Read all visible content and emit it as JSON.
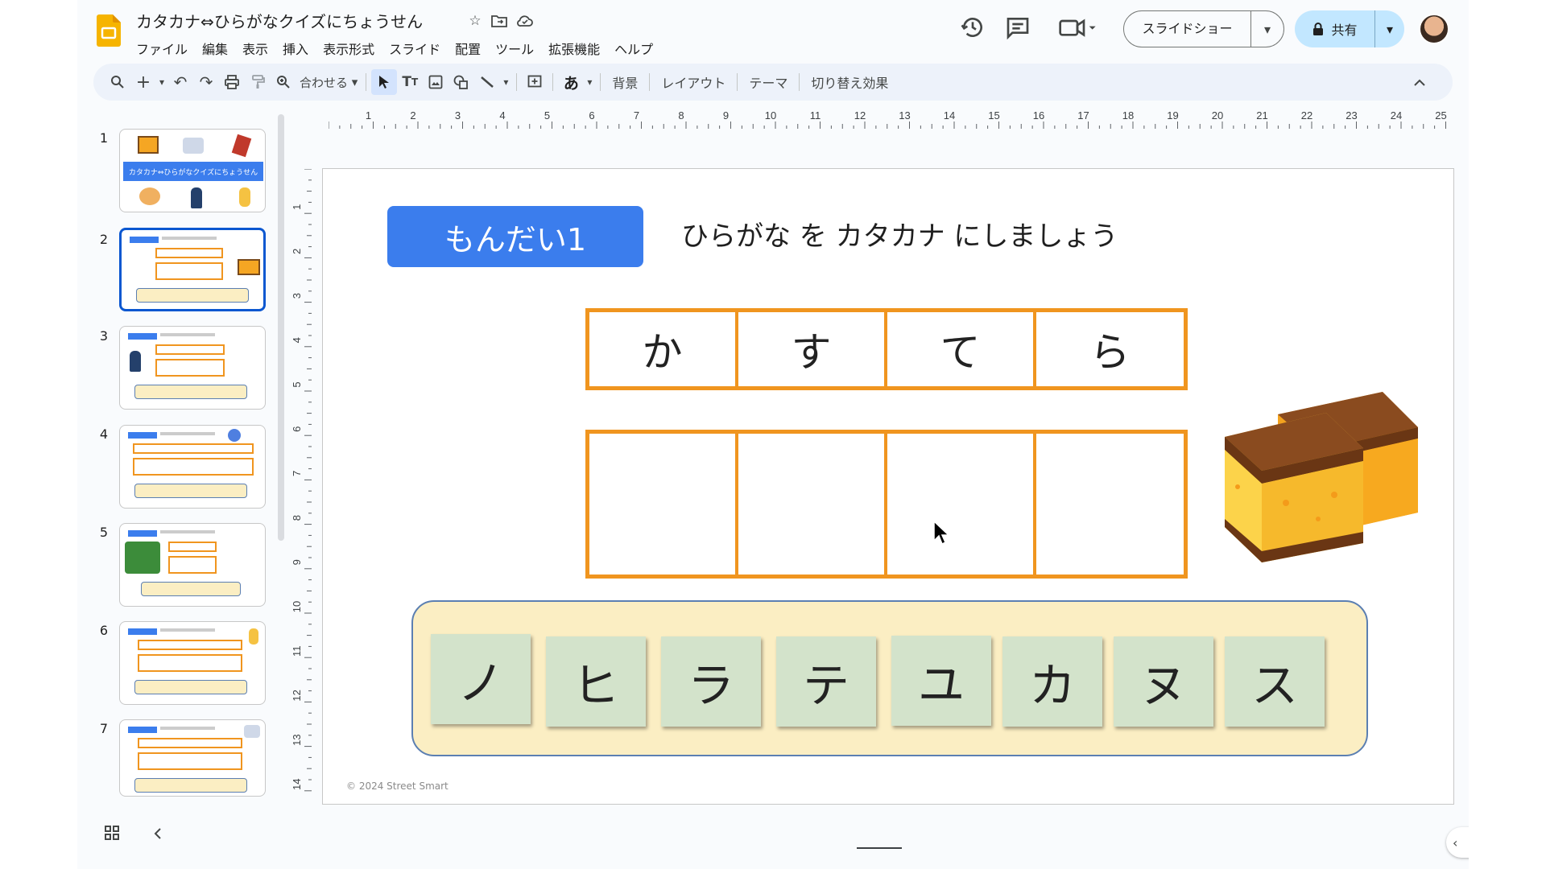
{
  "document": {
    "title": "カタカナ⇔ひらがなクイズにちょうせん"
  },
  "menu": [
    "ファイル",
    "編集",
    "表示",
    "挿入",
    "表示形式",
    "スライド",
    "配置",
    "ツール",
    "拡張機能",
    "ヘルプ"
  ],
  "header": {
    "slideshow_label": "スライドショー",
    "share_label": "共有"
  },
  "toolbar": {
    "zoom_label": "合わせる",
    "input_tool_glyph": "あ",
    "background_label": "背景",
    "layout_label": "レイアウト",
    "theme_label": "テーマ",
    "transition_label": "切り替え効果"
  },
  "filmstrip": {
    "numbers": [
      "1",
      "2",
      "3",
      "4",
      "5",
      "6",
      "7"
    ],
    "selected": "2"
  },
  "rulers": {
    "horizontal": [
      "1",
      "2",
      "3",
      "4",
      "5",
      "6",
      "7",
      "8",
      "9",
      "10",
      "11",
      "12",
      "13",
      "14",
      "15",
      "16",
      "17",
      "18",
      "19",
      "20",
      "21",
      "22",
      "23",
      "24",
      "25"
    ],
    "vertical": [
      "1",
      "2",
      "3",
      "4",
      "5",
      "6",
      "7",
      "8",
      "9",
      "10",
      "11",
      "12",
      "13",
      "14"
    ]
  },
  "slide": {
    "badge": "もんだい1",
    "instruction": "ひらがな を カタカナ にしましょう",
    "hiragana": [
      "か",
      "す",
      "て",
      "ら"
    ],
    "answers": [
      "",
      "",
      "",
      ""
    ],
    "tiles": [
      "ノ",
      "ヒ",
      "ラ",
      "テ",
      "ユ",
      "カ",
      "ヌ",
      "ス"
    ],
    "copyright": "© 2024 Street Smart"
  },
  "colors": {
    "accent_blue": "#3b7ded",
    "box_orange": "#f0951f",
    "bank_bg": "#fbeec3",
    "tile_green": "#d3e3cb",
    "share_bg": "#c2e7ff"
  }
}
